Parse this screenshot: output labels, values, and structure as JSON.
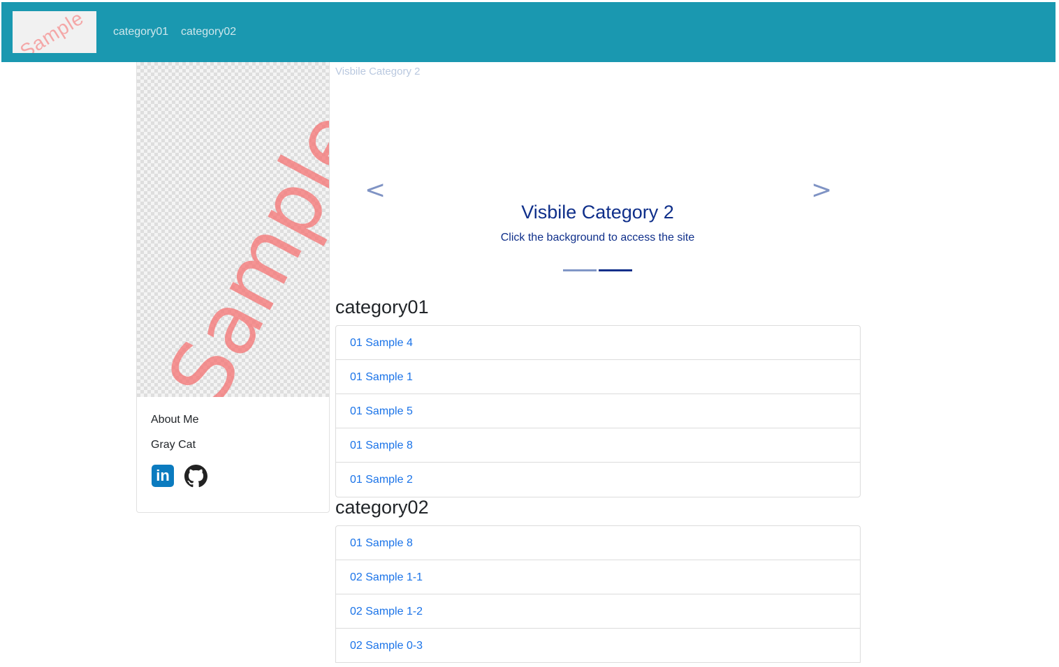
{
  "navbar": {
    "logo_text": "Sample",
    "links": [
      "category01",
      "category02"
    ],
    "background_color": "#1a98b0"
  },
  "profile": {
    "image_watermark": "Sample",
    "about_title": "About Me",
    "name": "Gray Cat",
    "social": {
      "linkedin_label": "in",
      "linkedin_icon": "linkedin-icon",
      "github_icon": "github-icon"
    }
  },
  "carousel": {
    "image_alt": "Visbile Category 2",
    "prev_label": "<",
    "next_label": ">",
    "title": "Visbile Category 2",
    "caption": "Click the background to access the site",
    "slide_count": 2,
    "active_slide": 2
  },
  "categories": [
    {
      "title": "category01",
      "items": [
        "01 Sample 4",
        "01 Sample 1",
        "01 Sample 5",
        "01 Sample 8",
        "01 Sample 2"
      ]
    },
    {
      "title": "category02",
      "items": [
        "01 Sample 8",
        "02 Sample 1-1",
        "02 Sample 1-2",
        "02 Sample 0-3"
      ]
    }
  ],
  "colors": {
    "link": "#1a73e8",
    "carousel_text": "#0f2f8a"
  }
}
